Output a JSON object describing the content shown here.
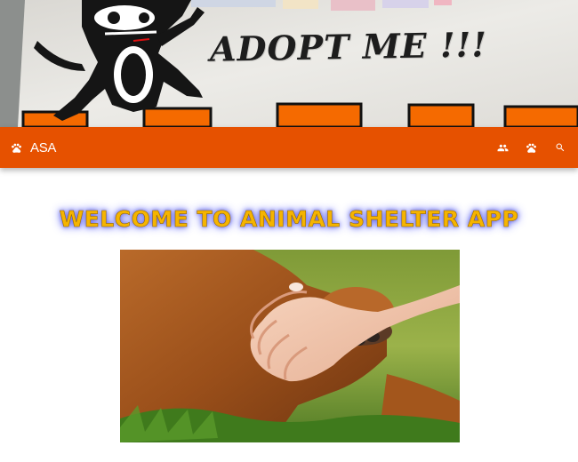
{
  "hero": {
    "banner_text": "ADOPT ME !!!"
  },
  "appbar": {
    "brand_label": "ASA",
    "brand_icon": "paw-icon",
    "actions": [
      {
        "icon": "people-icon"
      },
      {
        "icon": "paw-icon"
      },
      {
        "icon": "search-icon"
      }
    ],
    "background_color": "#e65100"
  },
  "main": {
    "welcome_title": "WELCOME TO ANIMAL SHELTER APP",
    "title_color": "#f5b400"
  }
}
